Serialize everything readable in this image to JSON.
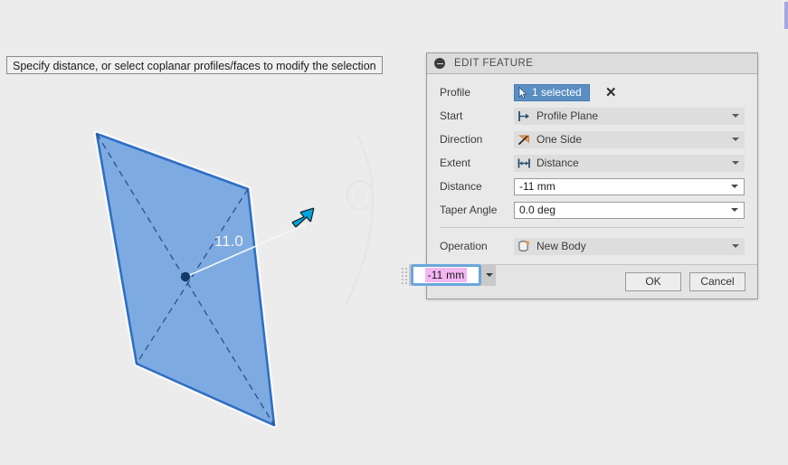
{
  "status_bar": {
    "message": "Specify distance, or select coplanar profiles/faces to modify the selection"
  },
  "panel": {
    "title": "EDIT FEATURE",
    "collapse_icon": "collapse-minus-icon",
    "rows": [
      {
        "label": "Profile",
        "type": "selection",
        "button_label": "1 selected",
        "button_icon": "select-cursor-icon",
        "clear_icon": "clear-x-icon"
      },
      {
        "label": "Start",
        "type": "combo",
        "value": "Profile Plane",
        "icon": "profile-plane-icon"
      },
      {
        "label": "Direction",
        "type": "combo",
        "value": "One Side",
        "icon": "one-side-arrow-icon"
      },
      {
        "label": "Extent",
        "type": "combo",
        "value": "Distance",
        "icon": "distance-arrows-icon"
      },
      {
        "label": "Distance",
        "type": "text",
        "value": "-11 mm"
      },
      {
        "label": "Taper Angle",
        "type": "text",
        "value": "0.0 deg"
      },
      {
        "label": "Operation",
        "type": "combo",
        "value": "New Body",
        "icon": "new-body-icon"
      }
    ],
    "footer": {
      "ok_label": "OK",
      "cancel_label": "Cancel"
    }
  },
  "floating_input": {
    "value": "-11 mm",
    "selected": true,
    "caret_icon": "chevron-down-icon",
    "grip_icon": "drag-grip-icon"
  },
  "viewport": {
    "dimension_label": "11.0",
    "manipulator_icon": "extrude-arrow-handle-icon",
    "center_point_icon": "sketch-point-icon",
    "profile_name": "extruded-profile-face"
  },
  "colors": {
    "background": "#ececec",
    "panel_bg": "#e9e9e9",
    "panel_header_bg": "#dcdcdc",
    "selection_blue": "#5b8fc4",
    "face_fill": "#74a5e0",
    "face_edge": "#2f6fc4",
    "manipulator_cyan": "#00a6e0",
    "text_selection_pink": "#f3b6f3",
    "field_focus_blue": "#6aa6dd",
    "icon_orange": "#f0a35e"
  }
}
